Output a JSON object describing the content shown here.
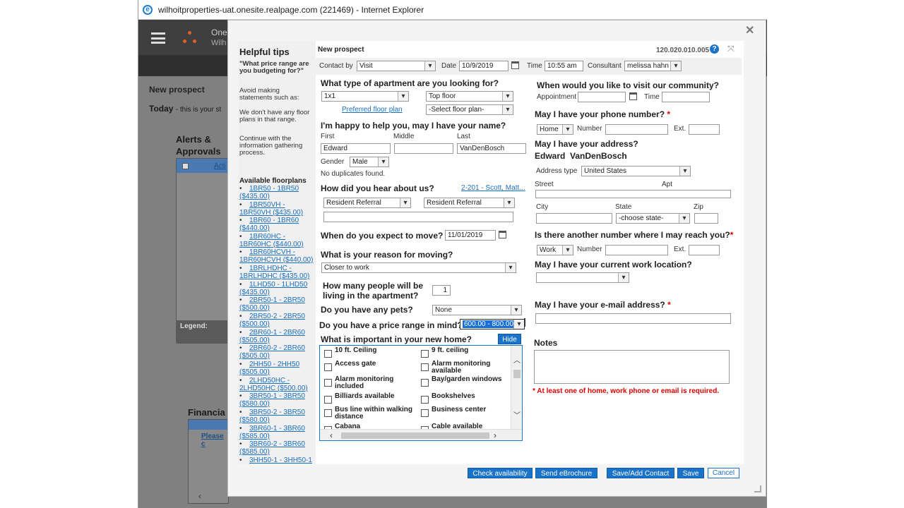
{
  "window": {
    "title": "wilhoitproperties-uat.onesite.realpage.com (221469) - Internet Explorer"
  },
  "background": {
    "brand_line1": "One",
    "brand_line2": "Wilh",
    "new_prospect": "New prospect",
    "today": "Today",
    "today_sub": "- this is your st",
    "alerts": "Alerts &",
    "approvals": "Approvals",
    "acti": "Acti",
    "legend": "Legend:",
    "financial": "Financia",
    "please": "Please c"
  },
  "tips": {
    "title": "Helpful tips",
    "question": "\"What price range are you budgeting for?\"",
    "avoid": "Avoid making statements such as:",
    "dont": "We don't have any floor plans in that range.",
    "continue": "Continue with the information gathering process.",
    "floorplans_title": "Available floorplans",
    "floorplans": [
      "1BR50 - 1BR50 ($435.00)",
      "1BR50VH - 1BR50VH ($435.00)",
      "1BR60 - 1BR60 ($440.00)",
      "1BR60HC - 1BR60HC ($440.00)",
      "1BR60HCVH - 1BR60HCVH ($440.00)",
      "1BRLHDHC - 1BRLHDHC ($435.00)",
      "1LHD50 - 1LHD50 ($435.00)",
      "2BR50-1 - 2BR50 ($500.00)",
      "2BR50-2 - 2BR50 ($500.00)",
      "2BR60-1 - 2BR60 ($505.00)",
      "2BR60-2 - 2BR60 ($505.00)",
      "2HH50 - 2HH50 ($505.00)",
      "2LHD50HC - 2LHD50HC ($500.00)",
      "3BR50-1 - 3BR50 ($580.00)",
      "3BR50-2 - 3BR50 ($580.00)",
      "3BR60-1 - 3BR60 ($585.00)",
      "3BR60-2 - 3BR60 ($585.00)",
      "3HH50-1 - 3HH50-1"
    ]
  },
  "form": {
    "title": "New prospect",
    "code": "120.020.010.005",
    "contact_by_label": "Contact by",
    "contact_by": "Visit",
    "date_label": "Date",
    "date": "10/9/2019",
    "time_label": "Time",
    "time": "10:55 am",
    "consultant_label": "Consultant",
    "consultant": "melissa hahn",
    "apt_type_q": "What type of apartment are you looking for?",
    "apt_type": "1x1",
    "floor": "Top floor",
    "preferred_floor_plan": "Preferred floor plan",
    "select_floor_plan": "-Select floor plan-",
    "name_q": "I'm happy to help you, may I have your name?",
    "first_label": "First",
    "middle_label": "Middle",
    "last_label": "Last",
    "first": "Edward",
    "middle": "",
    "last": "VanDenBosch",
    "gender_label": "Gender",
    "gender": "Male",
    "no_dupes": "No duplicates found.",
    "hear_q": "How did you hear about us?",
    "hear_link": "2-201 - Scott, Matt...",
    "hear1": "Resident Referral",
    "hear2": "Resident Referral",
    "move_q": "When do you expect to move?",
    "move_date": "11/01/2019",
    "reason_q": "What is your reason for moving?",
    "reason": "Closer to work",
    "people_q1": "How many people will be",
    "people_q2": "living in the apartment?",
    "people": "1",
    "pets_q": "Do you have any pets?",
    "pets": "None",
    "price_q": "Do you have a price range in mind?",
    "price": "600.00 - 800.00",
    "important_q": "What is important in your new home?",
    "hide": "Hide",
    "amenities_left": [
      "10 ft. Ceiling",
      "Access gate",
      "Alarm monitoring included",
      "Billiards available",
      "Bus line within walking distance",
      "Cabana"
    ],
    "amenities_right": [
      "9 ft. ceiling",
      "Alarm monitoring available",
      "Bay/garden windows",
      "Bookshelves",
      "Business center",
      "Cable available"
    ],
    "visit_q": "When would you like to visit our community?",
    "appointment_label": "Appointment",
    "appt_time_label": "Time",
    "phone_q": "May I have your phone number?",
    "phone_type": "Home",
    "number_label": "Number",
    "ext_label": "Ext.",
    "address_q": "May I have your address?",
    "address_name": "Edward  VanDenBosch",
    "address_type_label": "Address type",
    "address_type": "United States",
    "street_label": "Street",
    "apt_label": "Apt",
    "city_label": "City",
    "state_label": "State",
    "state": "-choose state-",
    "zip_label": "Zip",
    "other_q": "Is there another number where I may reach you?",
    "other_type": "Work",
    "work_q": "May I have your current work location?",
    "email_q": "May I have your e-mail address?",
    "notes_label": "Notes",
    "required_note": "* At least one of home, work phone or email is required.",
    "buttons": {
      "check": "Check availability",
      "ebrochure": "Send eBrochure",
      "save_add": "Save/Add Contact",
      "save": "Save",
      "cancel": "Cancel"
    }
  },
  "colors": {
    "accent": "#1a73c9",
    "required": "#dd0000",
    "link": "#1a6fbf"
  }
}
